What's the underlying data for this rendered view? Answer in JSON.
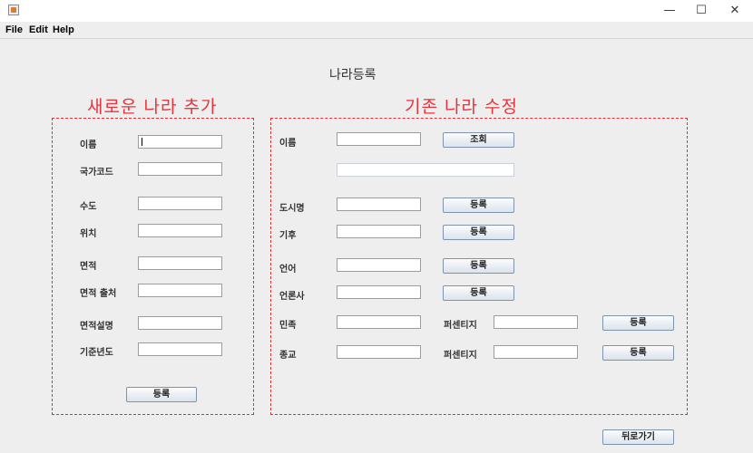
{
  "window": {
    "minimize": "—",
    "maximize": "☐",
    "close": "✕"
  },
  "menu": [
    "File",
    "Edit",
    "Help"
  ],
  "heading": "나라등록",
  "add_section": {
    "title": "새로운 나라 추가",
    "fields": [
      {
        "label": "이름",
        "value": ""
      },
      {
        "label": "국가코드",
        "value": ""
      },
      {
        "label": "수도",
        "value": ""
      },
      {
        "label": "위치",
        "value": ""
      },
      {
        "label": "면적",
        "value": ""
      },
      {
        "label": "면적 출처",
        "value": ""
      },
      {
        "label": "면적설명",
        "value": ""
      },
      {
        "label": "기준년도",
        "value": ""
      }
    ],
    "register_button": "등록"
  },
  "edit_section": {
    "title": "기존 나라 수정",
    "name_label": "이름",
    "lookup_button": "조회",
    "result_value": "",
    "rows": [
      {
        "label": "도시명",
        "button": "등록"
      },
      {
        "label": "기후",
        "button": "등록"
      },
      {
        "label": "언어",
        "button": "등록"
      },
      {
        "label": "언론사",
        "button": "등록"
      }
    ],
    "percent_rows": [
      {
        "label": "민족",
        "percent_label": "퍼센티지",
        "button": "등록"
      },
      {
        "label": "종교",
        "percent_label": "퍼센티지",
        "button": "등록"
      }
    ]
  },
  "back_button": "뒤로가기"
}
